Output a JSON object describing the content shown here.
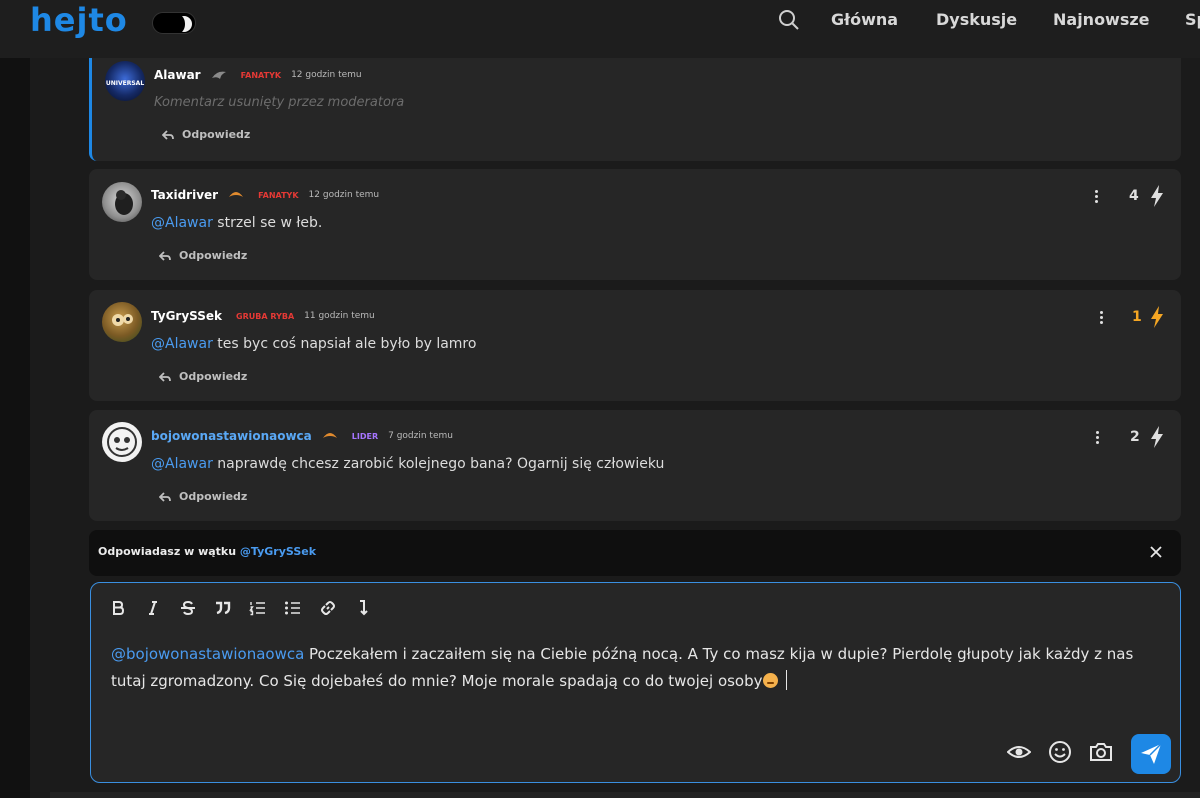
{
  "header": {
    "logo": "hejto",
    "nav": [
      "Główna",
      "Dyskusje",
      "Najnowsze",
      "Sp"
    ]
  },
  "comments": [
    {
      "author": "Alawar",
      "rank": "FANATYK",
      "time": "12 godzin temu",
      "mention": "",
      "text": "Komentarz usunięty przez moderatora",
      "reply_label": "Odpowiedz"
    },
    {
      "author": "Taxidriver",
      "rank": "FANATYK",
      "time": "12 godzin temu",
      "mention": "@Alawar",
      "text": " strzel se w łeb.",
      "reply_label": "Odpowiedz",
      "votes": "4"
    },
    {
      "author": "TyGrySSek",
      "rank": "GRUBA RYBA",
      "time": "11 godzin temu",
      "mention": "@Alawar",
      "text": " tes byc coś napsiał ale było by lamro",
      "reply_label": "Odpowiedz",
      "votes": "1"
    },
    {
      "author": "bojowonastawionaowca",
      "rank": "LIDER",
      "time": "7 godzin temu",
      "mention": "@Alawar",
      "text": " naprawdę chcesz zarobić kolejnego bana? Ogarnij się człowieku",
      "reply_label": "Odpowiedz",
      "votes": "2"
    }
  ],
  "reply_bar": {
    "prefix": "Odpowiadasz w wątku ",
    "user": "@TyGrySSek"
  },
  "editor": {
    "mention": "@bojowonastawionaowca",
    "text": " Poczekałem i zaczaiłem się na Ciebie późną nocą. A Ty co masz kija w dupie? Pierdolę głupoty jak każdy z nas tutaj zgromadzony. Co Się dojebałeś do mnie? Moje morale spadają co do twojej osoby"
  },
  "colors": {
    "accent": "#1e88e5",
    "rank_red": "#e53935",
    "rank_lider": "#a675ff",
    "vote_active": "#f5a623"
  }
}
